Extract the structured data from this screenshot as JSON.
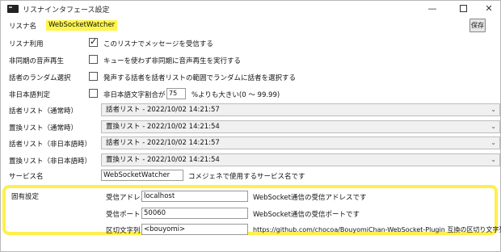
{
  "window": {
    "title": "リスナインタフェース設定"
  },
  "header": {
    "listener_label": "リスナ名",
    "listener_name": "WebSocketWatcher",
    "save_label": "保存"
  },
  "options": [
    {
      "label": "リスナ利用",
      "checked": true,
      "text": "このリスナでメッセージを受信する"
    },
    {
      "label": "非同期の音声再生",
      "checked": false,
      "text": "キューを使わず非同期に音声再生を実行する"
    },
    {
      "label": "話者のランダム選択",
      "checked": false,
      "text": "発声する話者を話者リストの範囲でランダムに話者を選択する"
    },
    {
      "label": "非日本語判定",
      "checked": false,
      "text": "非日本語文字割合が",
      "num": "75",
      "after": "%よりも大きい(0 ～ 99.99)"
    }
  ],
  "lists": [
    {
      "label": "話者リスト（通常時）",
      "value": "話者リスト - 2022/10/02 14:21:57"
    },
    {
      "label": "置換リスト（通常時）",
      "value": "置換リスト - 2022/10/02 14:21:54"
    },
    {
      "label": "話者リスト（非日本語時）",
      "value": "話者リスト - 2022/10/02 14:21:57"
    },
    {
      "label": "置換リスト（非日本語時）",
      "value": "置換リスト - 2022/10/02 14:21:54"
    }
  ],
  "service": {
    "label": "サービス名",
    "value": "WebSocketWatcher",
    "desc": "コメジェネで使用するサービス名です"
  },
  "specific": {
    "label": "固有設定",
    "rows": [
      {
        "label": "受信アドレス",
        "value": "localhost",
        "desc": "WebSocket通信の受信アドレスです"
      },
      {
        "label": "受信ポート",
        "value": "50060",
        "desc": "WebSocket通信の受信ポートです"
      },
      {
        "label": "区切文字列",
        "value": "<bouyomi>",
        "desc": "https://github.com/chocoa/BouyomiChan-WebSocket-Plugin 互換の区切り文字列です"
      }
    ]
  },
  "colors": {
    "highlight": "#fff54a",
    "frame": "#ffef4d"
  }
}
